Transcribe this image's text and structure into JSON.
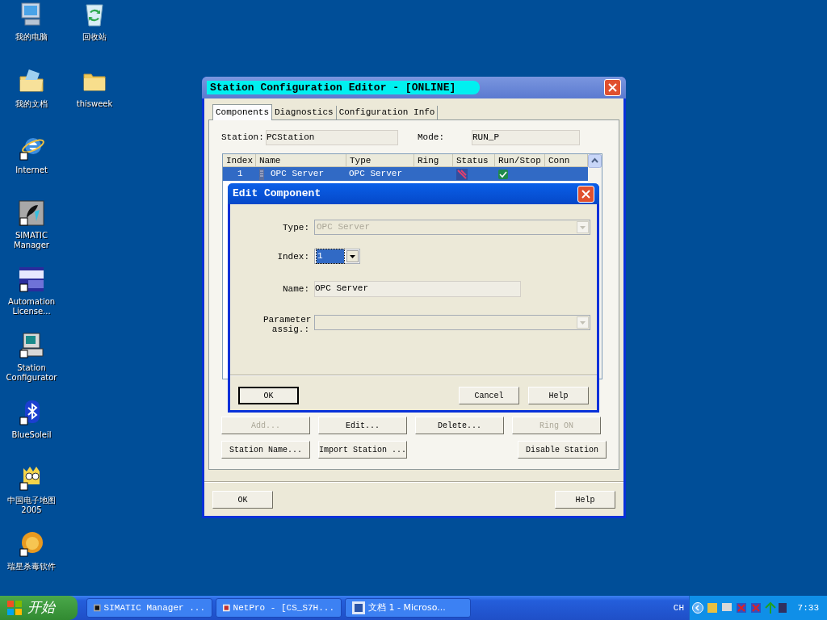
{
  "desktop_icons": [
    {
      "label": "我的电脑",
      "kind": "computer"
    },
    {
      "label": "回收站",
      "kind": "recycle"
    },
    {
      "label": "我的文档",
      "kind": "documents"
    },
    {
      "label": "thisweek",
      "kind": "folder"
    },
    {
      "label": "Internet",
      "kind": "browser"
    },
    {
      "label": "SIMATIC Manager",
      "kind": "simatic"
    },
    {
      "label": "Automation License...",
      "kind": "license"
    },
    {
      "label": "Station Configurator",
      "kind": "station"
    },
    {
      "label": "BlueSoleil",
      "kind": "bluetooth"
    },
    {
      "label": "中国电子地图 2005",
      "kind": "map"
    },
    {
      "label": "瑞星杀毒软件",
      "kind": "antivirus"
    }
  ],
  "main_window": {
    "title": "Station Configuration Editor - [ONLINE]",
    "tabs": [
      {
        "label": "Components",
        "selected": true
      },
      {
        "label": "Diagnostics",
        "selected": false
      },
      {
        "label": "Configuration Info",
        "selected": false
      }
    ],
    "station_label": "Station:",
    "station_value": "PCStation",
    "mode_label": "Mode:",
    "mode_value": "RUN_P",
    "table": {
      "columns": [
        "Index",
        "Name",
        "Type",
        "Ring",
        "Status",
        "Run/Stop",
        "Conn"
      ],
      "rows": [
        {
          "index": "1",
          "name": "OPC Server",
          "type": "OPC Server",
          "selected": true
        }
      ]
    },
    "button_rows": [
      {
        "left": [
          {
            "label": "Add...",
            "disabled": true
          },
          {
            "label": "Edit...",
            "disabled": false
          },
          {
            "label": "Delete...",
            "disabled": false
          },
          {
            "label": "Ring ON",
            "disabled": true
          }
        ]
      },
      {
        "left": [
          {
            "label": "Station Name...",
            "disabled": false
          },
          {
            "label": "Import Station ...",
            "disabled": false
          }
        ],
        "right": [
          {
            "label": "Disable Station",
            "disabled": false
          }
        ]
      }
    ],
    "footer_buttons": [
      {
        "label": "OK"
      },
      {
        "label": "Help"
      }
    ]
  },
  "edit_dialog": {
    "title": "Edit Component",
    "fields": [
      {
        "kind": "combo",
        "label": "Type:",
        "value": "OPC Server",
        "disabled": true
      },
      {
        "kind": "small_combo",
        "label": "Index:",
        "value": "1",
        "selected": true
      },
      {
        "kind": "text",
        "label": "Name:",
        "value": "OPC Server"
      },
      {
        "kind": "combo",
        "label": "Parameter assig.:",
        "disabled": true
      }
    ],
    "buttons": [
      {
        "label": "OK",
        "default": true
      },
      {
        "label": "Cancel",
        "default": false
      },
      {
        "label": "Help",
        "default": false
      }
    ]
  },
  "taskbar": {
    "start": "开始",
    "tasks": [
      {
        "label": "SIMATIC Manager ...",
        "kind": "simatic"
      },
      {
        "label": "NetPro - [CS_S7H...",
        "kind": "netpro"
      },
      {
        "label": "文档 1 - Microso...",
        "kind": "word"
      }
    ],
    "language": "CH",
    "clock": "7:33"
  }
}
